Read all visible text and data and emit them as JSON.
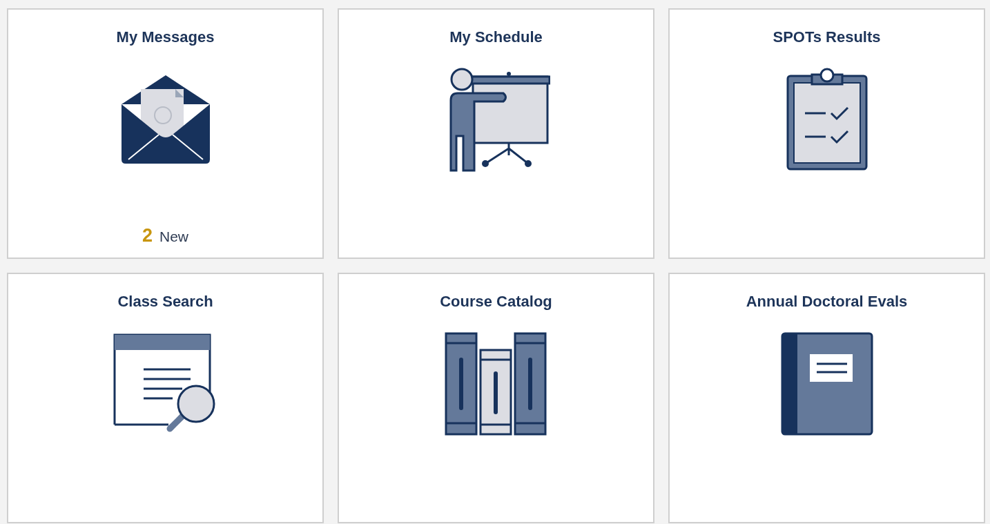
{
  "tiles": [
    {
      "title": "My Messages",
      "count": "2",
      "count_label": "New"
    },
    {
      "title": "My Schedule"
    },
    {
      "title": "SPOTs Results"
    },
    {
      "title": "Class Search"
    },
    {
      "title": "Course Catalog"
    },
    {
      "title": "Annual Doctoral Evals"
    }
  ]
}
